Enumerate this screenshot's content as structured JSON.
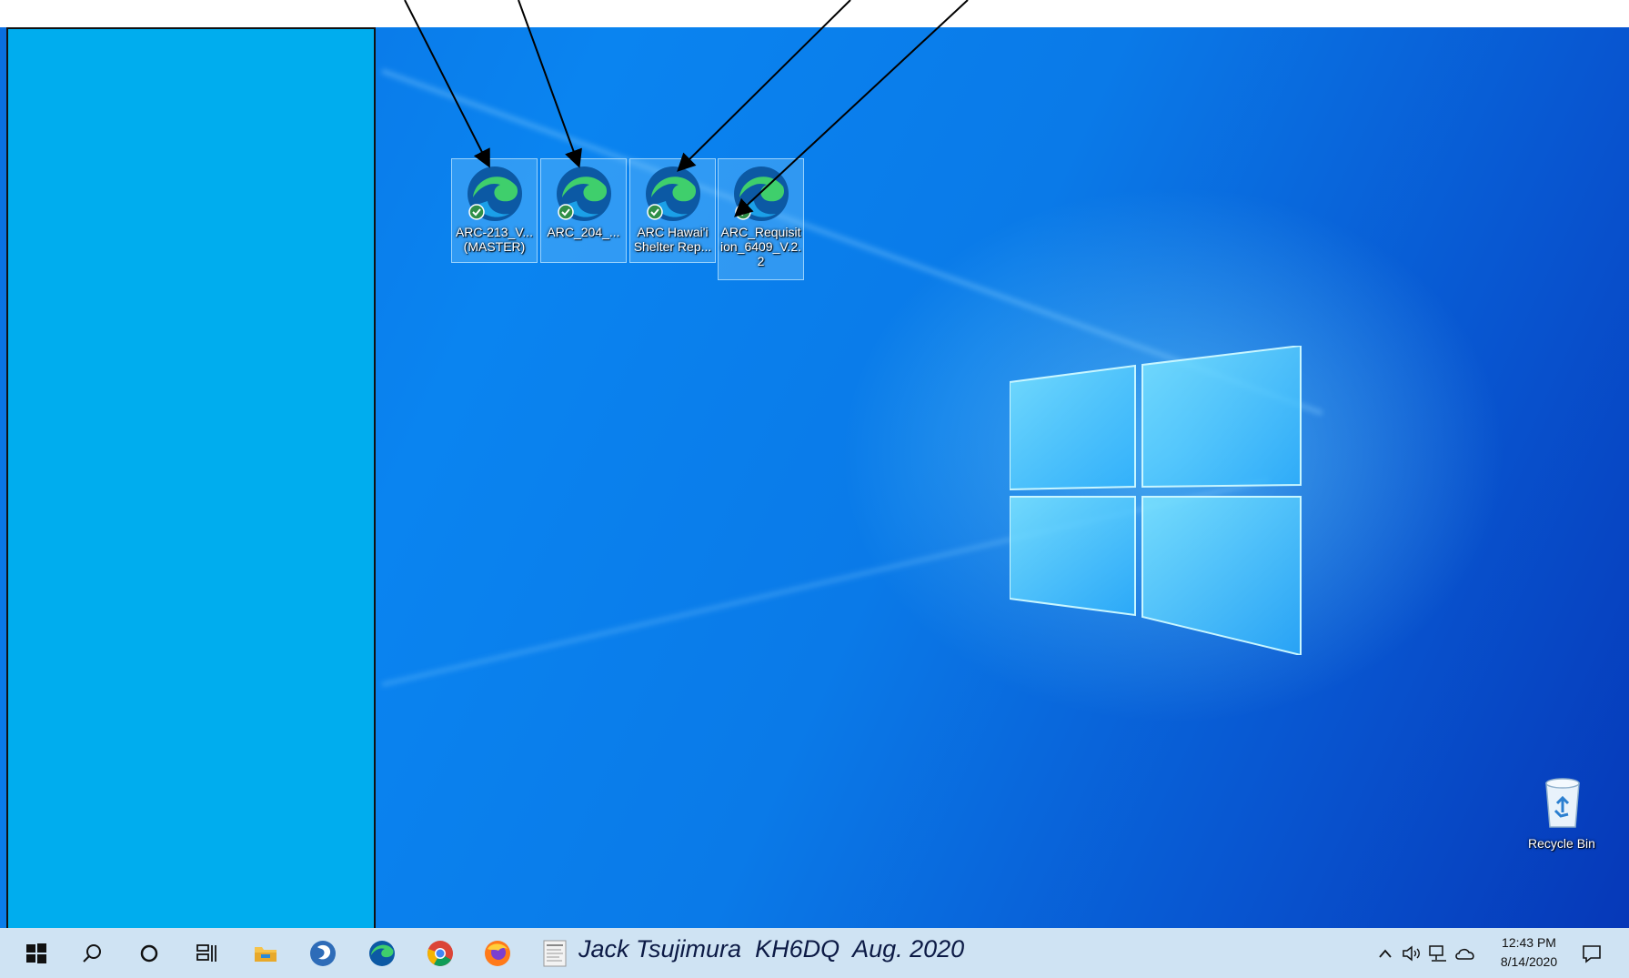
{
  "desktop": {
    "icons": [
      {
        "label_line1": "ARC-213_V...",
        "label_line2": "(MASTER)",
        "label_line3": ""
      },
      {
        "label_line1": "ARC_204_...",
        "label_line2": "",
        "label_line3": ""
      },
      {
        "label_line1": "ARC Hawai'i",
        "label_line2": "Shelter Rep...",
        "label_line3": ""
      },
      {
        "label_line1": "ARC_Requisit",
        "label_line2": "ion_6409_V.2.",
        "label_line3": "2"
      }
    ],
    "recycle_bin_label": "Recycle Bin"
  },
  "taskbar": {
    "caption": "Jack Tsujimura  KH6DQ  Aug. 2020",
    "time": "12:43 PM",
    "date": "8/14/2020",
    "items": [
      "start-icon",
      "search-icon",
      "cortana-icon",
      "task-view-icon",
      "file-explorer-icon",
      "app-icon",
      "edge-icon",
      "chrome-icon",
      "firefox-icon",
      "document-icon"
    ]
  },
  "colors": {
    "left_panel": "#00adee",
    "taskbar": "#cfe3f3",
    "edge_blue": "#0c59a4",
    "edge_green": "#3fcf6c"
  }
}
